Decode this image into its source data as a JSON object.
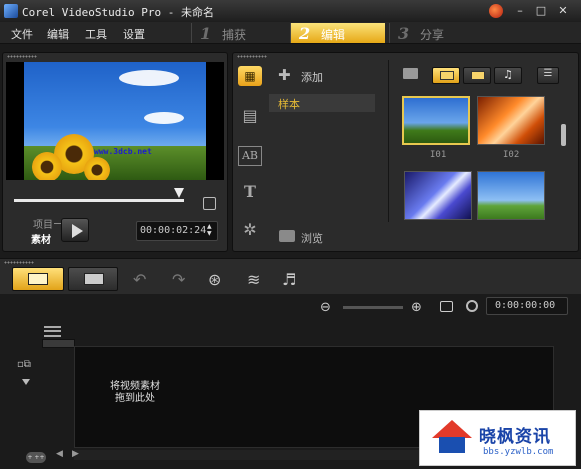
{
  "window": {
    "title": "Corel VideoStudio Pro - 未命名",
    "controls": {
      "minimize": "–",
      "maximize": "□",
      "close": "✕"
    }
  },
  "menu": {
    "items": [
      "文件",
      "编辑",
      "工具",
      "设置"
    ]
  },
  "steps": [
    {
      "num": "1",
      "label": "捕获",
      "active": false
    },
    {
      "num": "2",
      "label": "编辑",
      "active": true
    },
    {
      "num": "3",
      "label": "分享",
      "active": false
    }
  ],
  "preview": {
    "watermark_text": "www.3dcb.net",
    "mode_project": "项目",
    "mode_clip": "素材",
    "timecode": "00:00:02:24",
    "scrub_position": 0.97
  },
  "library": {
    "add_label": "添加",
    "folders": [
      "样本"
    ],
    "browse_label": "浏览",
    "thumbnails": [
      {
        "label": "I01",
        "selected": true
      },
      {
        "label": "I02",
        "selected": false
      },
      {
        "label": "",
        "selected": false
      },
      {
        "label": "",
        "selected": false
      }
    ]
  },
  "timeline": {
    "duration": "0:00:00:00",
    "drop_hint": "将视频素材拖到此处",
    "add_track_label": "+ ++"
  },
  "badge": {
    "title": "晓枫资讯",
    "url": "bbs.yzwlb.com"
  },
  "colors": {
    "accent": "#e6a817",
    "panel_bg": "#2b2b2b",
    "badge_blue": "#1a44a8",
    "badge_red": "#e23a2a"
  }
}
